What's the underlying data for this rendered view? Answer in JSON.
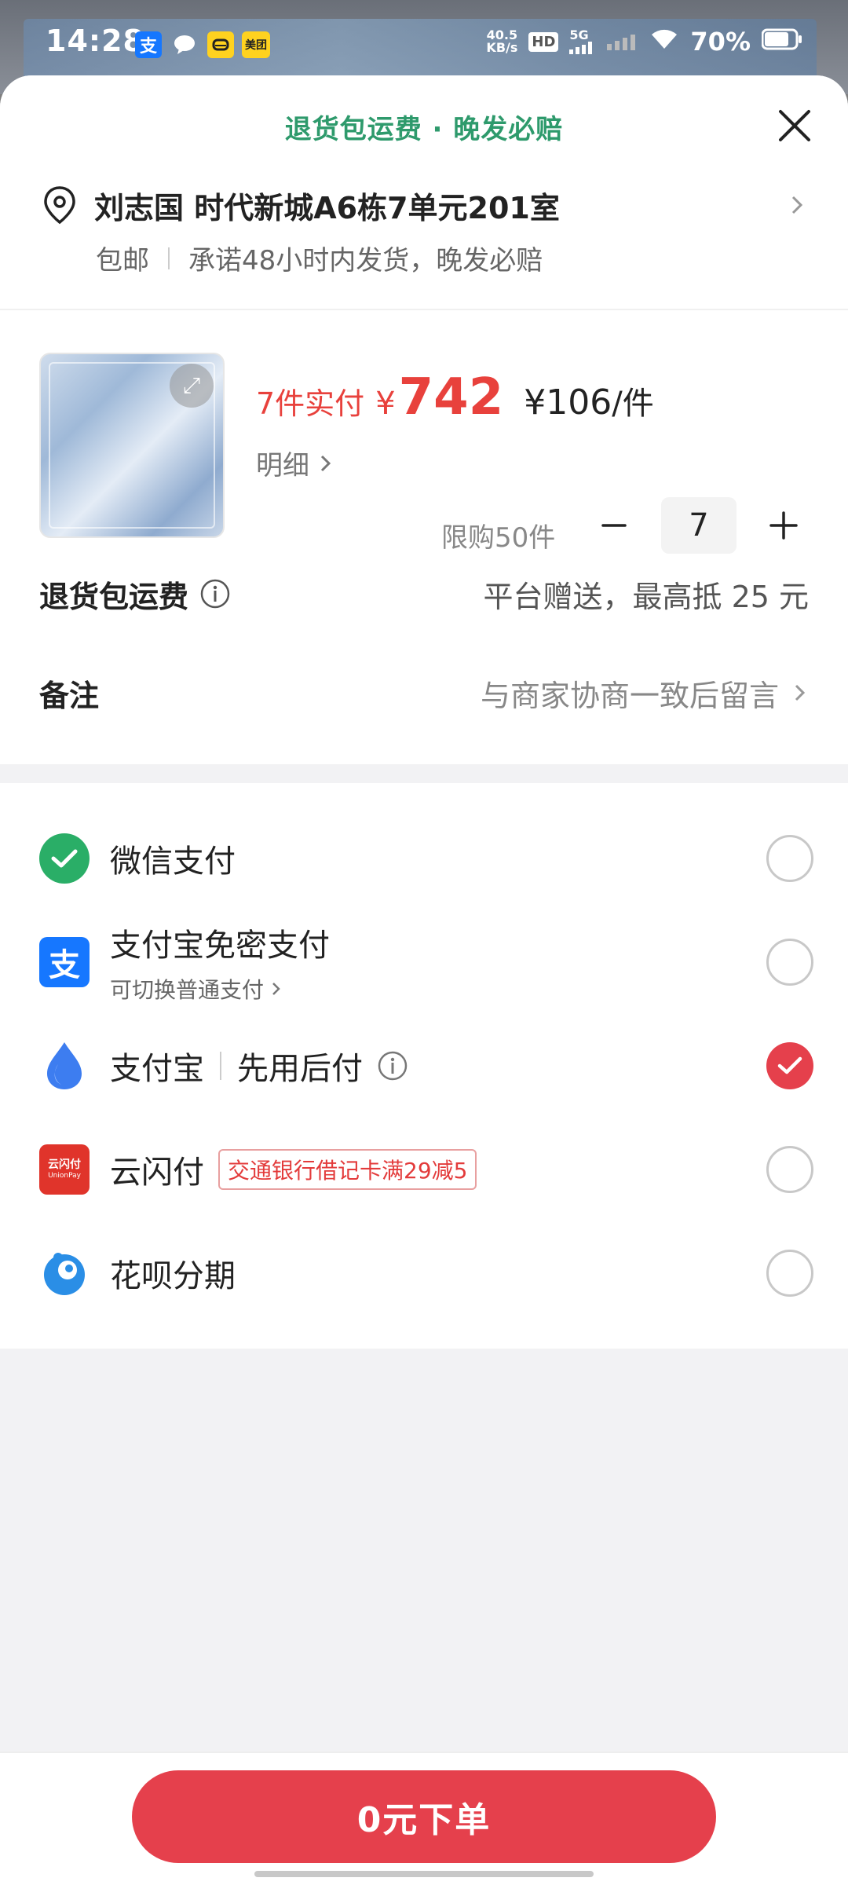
{
  "status_bar": {
    "time": "14:28",
    "alipay_icon_label": "支",
    "meituan_label": "美团",
    "net_speed_top": "40.5",
    "net_speed_bottom": "KB/s",
    "hd_label": "HD",
    "network": "5G",
    "battery": "70%"
  },
  "header": {
    "title": "退货包运费 · 晚发必赔"
  },
  "address": {
    "full": "刘志国 时代新城A6栋7单元201室",
    "shipping": "包邮",
    "promise": "承诺48小时内发货，晚发必赔"
  },
  "product": {
    "qty_label": "7件实付",
    "currency": "¥",
    "total": "742",
    "unit_price": "¥106",
    "unit_suffix": "/件",
    "detail_label": "明细",
    "limit_label": "限购50件",
    "quantity": "7"
  },
  "return_shipping": {
    "title": "退货包运费",
    "value": "平台赠送，最高抵 25 元"
  },
  "remark": {
    "title": "备注",
    "placeholder": "与商家协商一致后留言"
  },
  "payment": {
    "wechat": {
      "label": "微信支付",
      "selected": false
    },
    "alipay_nopwd": {
      "label": "支付宝免密支付",
      "sub": "可切换普通支付",
      "selected": false
    },
    "alipay_later": {
      "label": "支付宝",
      "label2": "先用后付",
      "selected": true
    },
    "unionpay": {
      "label": "云闪付",
      "promo": "交通银行借记卡满29减5",
      "selected": false,
      "icon_text": "云闪付",
      "icon_sub": "UnionPay"
    },
    "huabei": {
      "label": "花呗分期",
      "selected": false
    }
  },
  "footer": {
    "submit_label": "0元下单"
  },
  "colors": {
    "accent_red": "#e5404c",
    "header_green": "#2e9a6c",
    "price_red": "#e8413c"
  }
}
